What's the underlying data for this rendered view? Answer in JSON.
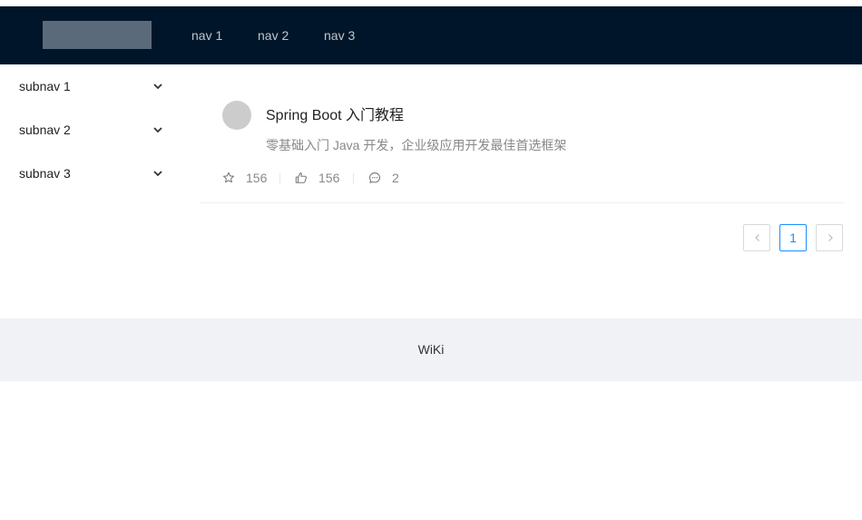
{
  "header": {
    "nav": [
      "nav 1",
      "nav 2",
      "nav 3"
    ]
  },
  "sidebar": {
    "items": [
      {
        "label": "subnav 1",
        "icon": "chevron-down-icon"
      },
      {
        "label": "subnav 2",
        "icon": "chevron-down-icon"
      },
      {
        "label": "subnav 3",
        "icon": "chevron-down-icon"
      }
    ]
  },
  "list": {
    "items": [
      {
        "title": "Spring Boot 入门教程",
        "description": "零基础入门 Java 开发，企业级应用开发最佳首选框架",
        "actions": [
          {
            "icon": "star-icon",
            "value": "156"
          },
          {
            "icon": "like-icon",
            "value": "156"
          },
          {
            "icon": "message-icon",
            "value": "2"
          }
        ]
      }
    ]
  },
  "pagination": {
    "current": "1",
    "prev_icon": "chevron-left-icon",
    "next_icon": "chevron-right-icon"
  },
  "footer": {
    "text": "WiKi"
  },
  "colors": {
    "header_bg": "#001529",
    "footer_bg": "#f0f2f5",
    "accent": "#1890ff"
  }
}
